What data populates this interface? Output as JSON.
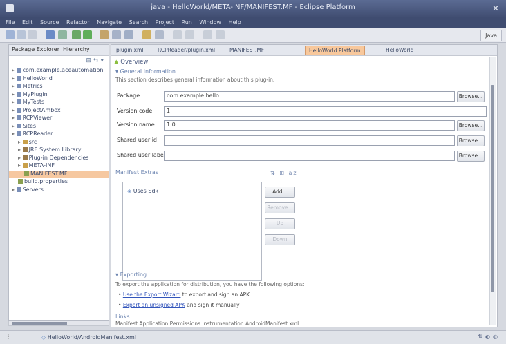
{
  "window": {
    "title": "java - HelloWorld/META-INF/MANIFEST.MF - Eclipse Platform"
  },
  "menu": [
    "File",
    "Edit",
    "Source",
    "Refactor",
    "Navigate",
    "Search",
    "Project",
    "Run",
    "Window",
    "Help"
  ],
  "toolbar": {
    "perspective_label": "Java"
  },
  "left_view": {
    "tabs": [
      "Package Explorer",
      "Hierarchy"
    ],
    "tree": [
      "com.example.aceautomation",
      "HelloWorld",
      "Metrics",
      "MyPlugin",
      "MyTests",
      "ProjectAmbox",
      "RCPViewer",
      "Sites",
      "RCPReader",
      "src",
      "JRE System Library",
      "Plug-in Dependencies",
      "META-INF",
      "MANIFEST.MF",
      "build.properties",
      "Servers"
    ],
    "selected_index": 13
  },
  "editor": {
    "tabs": [
      "plugin.xml",
      "RCPReader/plugin.xml",
      "MANIFEST.MF",
      "HelloWorld Platform",
      "HelloWorld"
    ],
    "active_tab": 3,
    "header": "Overview",
    "general": {
      "title": "General Information",
      "desc": "This section describes general information about this plug-in.",
      "fields": [
        {
          "label": "Package",
          "value": "com.example.hello",
          "button": "Browse..."
        },
        {
          "label": "Version code",
          "value": "1",
          "button": ""
        },
        {
          "label": "Version name",
          "value": "1.0",
          "button": "Browse..."
        },
        {
          "label": "Shared user id",
          "value": "",
          "button": "Browse..."
        },
        {
          "label": "Shared user label",
          "value": "",
          "button": "Browse..."
        }
      ]
    },
    "extras": {
      "title": "Manifest Extras",
      "items": [
        "Uses Sdk"
      ],
      "buttons": [
        "Add...",
        "Remove...",
        "Up",
        "Down"
      ]
    },
    "exporting": {
      "title": "Exporting",
      "desc": "To export the application for distribution, you have the following options:",
      "lines": [
        {
          "link": "Use the Export Wizard",
          "rest": " to export and sign an APK"
        },
        {
          "link": "Export an unsigned APK",
          "rest": " and sign it manually"
        }
      ]
    },
    "links": {
      "title": "Links",
      "desc": "Manifest  Application  Permissions  Instrumentation  AndroidManifest.xml"
    }
  },
  "status": {
    "text": "HelloWorld/AndroidManifest.xml"
  }
}
